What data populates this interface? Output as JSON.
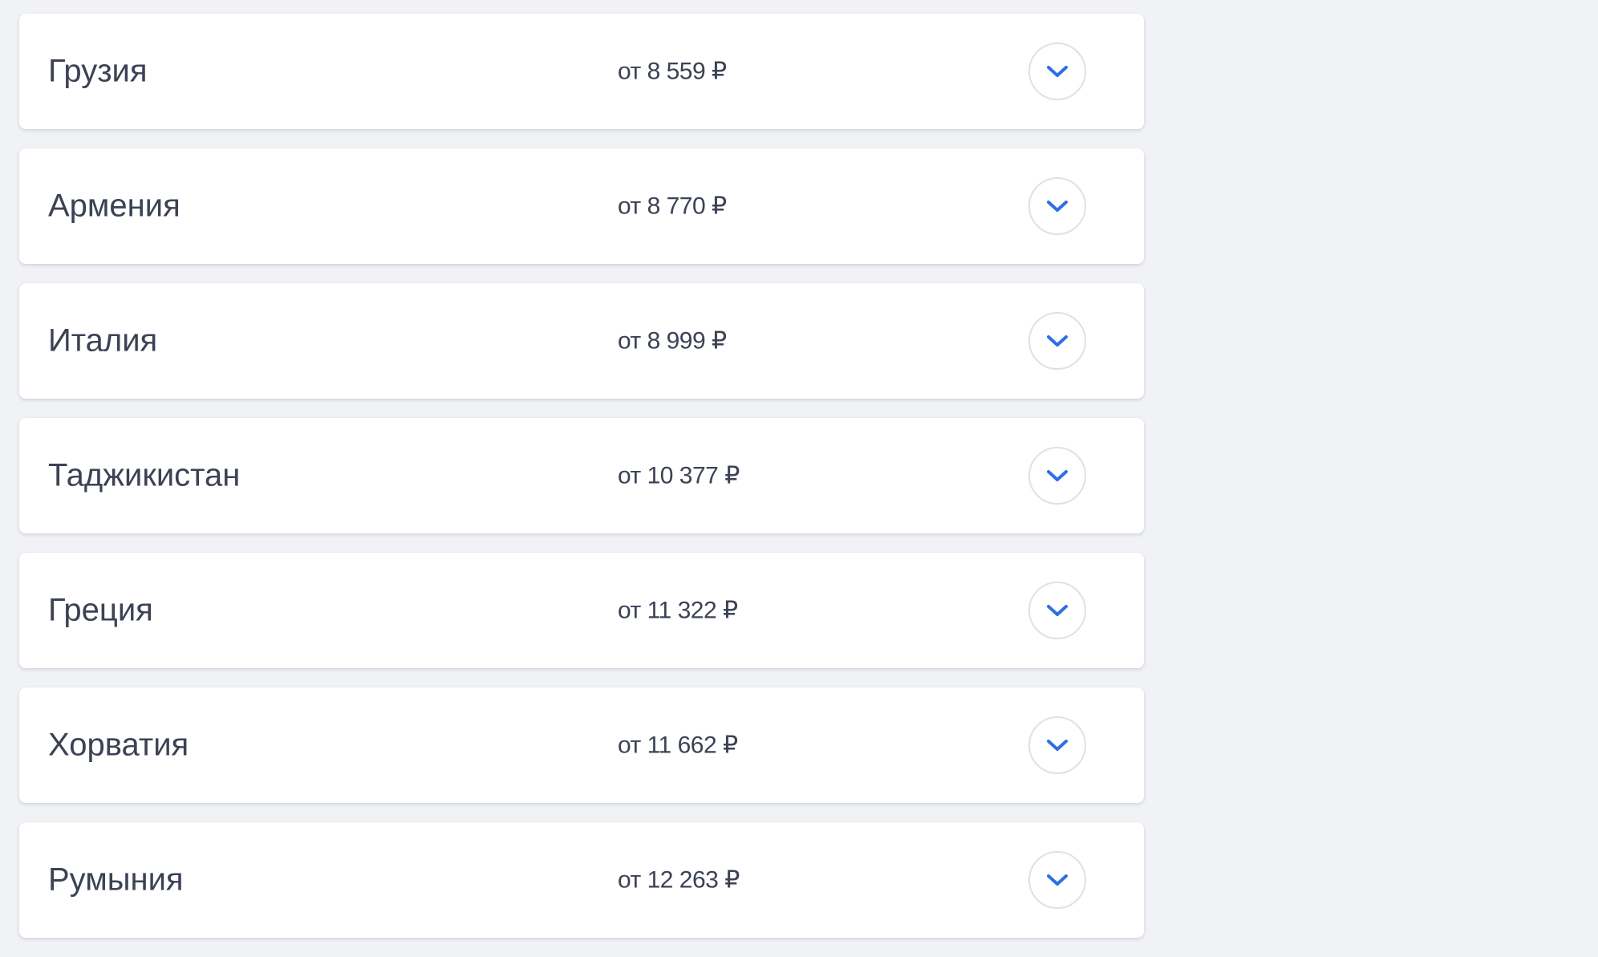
{
  "theme": {
    "background": "#f1f2f6",
    "card_background": "#ffffff",
    "text_color": "#3c4255",
    "accent": "#2f6fe4",
    "toggle_border": "#dfe1e8"
  },
  "icons": {
    "toggle": "chevron-down-icon"
  },
  "countries": [
    {
      "name": "Грузия",
      "price": "от 8 559 ₽"
    },
    {
      "name": "Армения",
      "price": "от 8 770 ₽"
    },
    {
      "name": "Италия",
      "price": "от 8 999 ₽"
    },
    {
      "name": "Таджикистан",
      "price": "от 10 377 ₽"
    },
    {
      "name": "Греция",
      "price": "от 11 322 ₽"
    },
    {
      "name": "Хорватия",
      "price": "от 11 662 ₽"
    },
    {
      "name": "Румыния",
      "price": "от 12 263 ₽"
    }
  ]
}
